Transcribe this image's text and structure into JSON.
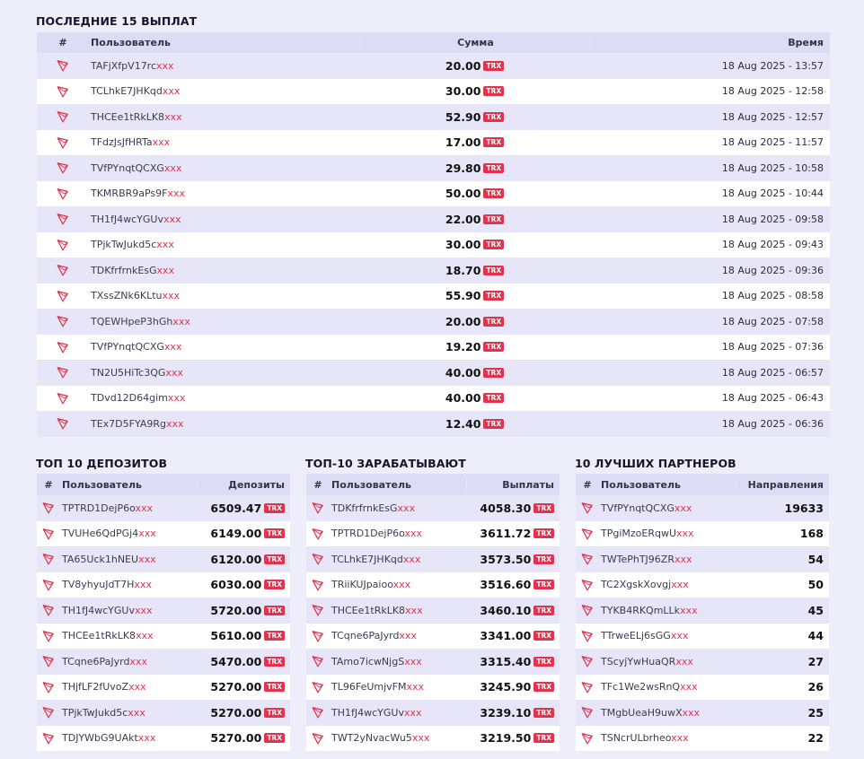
{
  "last_payouts": {
    "title": "ПОСЛЕДНИЕ 15 ВЫПЛАТ",
    "headers": {
      "num": "#",
      "user": "Пользователь",
      "sum": "Сумма",
      "time": "Время"
    },
    "currency": "TRX",
    "mask": "xxx",
    "rows": [
      {
        "user": "TAFjXfpV17rc",
        "amount": "20.00",
        "time": "18 Aug 2025 - 13:57"
      },
      {
        "user": "TCLhkE7JHKqd",
        "amount": "30.00",
        "time": "18 Aug 2025 - 12:58"
      },
      {
        "user": "THCEe1tRkLK8",
        "amount": "52.90",
        "time": "18 Aug 2025 - 12:57"
      },
      {
        "user": "TFdzJsJfHRTa",
        "amount": "17.00",
        "time": "18 Aug 2025 - 11:57"
      },
      {
        "user": "TVfPYnqtQCXG",
        "amount": "29.80",
        "time": "18 Aug 2025 - 10:58"
      },
      {
        "user": "TKMRBR9aPs9F",
        "amount": "50.00",
        "time": "18 Aug 2025 - 10:44"
      },
      {
        "user": "TH1fJ4wcYGUv",
        "amount": "22.00",
        "time": "18 Aug 2025 - 09:58"
      },
      {
        "user": "TPjkTwJukd5c",
        "amount": "30.00",
        "time": "18 Aug 2025 - 09:43"
      },
      {
        "user": "TDKfrfrnkEsG",
        "amount": "18.70",
        "time": "18 Aug 2025 - 09:36"
      },
      {
        "user": "TXssZNk6KLtu",
        "amount": "55.90",
        "time": "18 Aug 2025 - 08:58"
      },
      {
        "user": "TQEWHpeP3hGh",
        "amount": "20.00",
        "time": "18 Aug 2025 - 07:58"
      },
      {
        "user": "TVfPYnqtQCXG",
        "amount": "19.20",
        "time": "18 Aug 2025 - 07:36"
      },
      {
        "user": "TN2U5HiTc3QG",
        "amount": "40.00",
        "time": "18 Aug 2025 - 06:57"
      },
      {
        "user": "TDvd12D64gim",
        "amount": "40.00",
        "time": "18 Aug 2025 - 06:43"
      },
      {
        "user": "TEx7D5FYA9Rg",
        "amount": "12.40",
        "time": "18 Aug 2025 - 06:36"
      }
    ]
  },
  "top_deposits": {
    "title": "ТОП 10 ДЕПОЗИТОВ",
    "headers": {
      "num": "#",
      "user": "Пользователь",
      "value": "Депозиты"
    },
    "rows": [
      {
        "user": "TPTRD1DejP6o",
        "value": "6509.47"
      },
      {
        "user": "TVUHe6QdPGj4",
        "value": "6149.00"
      },
      {
        "user": "TA65Uck1hNEU",
        "value": "6120.00"
      },
      {
        "user": "TV8yhyuJdT7H",
        "value": "6030.00"
      },
      {
        "user": "TH1fJ4wcYGUv",
        "value": "5720.00"
      },
      {
        "user": "THCEe1tRkLK8",
        "value": "5610.00"
      },
      {
        "user": "TCqne6PaJyrd",
        "value": "5470.00"
      },
      {
        "user": "THjfLF2fUvoZ",
        "value": "5270.00"
      },
      {
        "user": "TPjkTwJukd5c",
        "value": "5270.00"
      },
      {
        "user": "TDJYWbG9UAkt",
        "value": "5270.00"
      }
    ]
  },
  "top_earners": {
    "title": "ТОП-10 ЗАРАБАТЫВАЮТ",
    "headers": {
      "num": "#",
      "user": "Пользователь",
      "value": "Выплаты"
    },
    "rows": [
      {
        "user": "TDKfrfrnkEsG",
        "value": "4058.30"
      },
      {
        "user": "TPTRD1DejP6o",
        "value": "3611.72"
      },
      {
        "user": "TCLhkE7JHKqd",
        "value": "3573.50"
      },
      {
        "user": "TRiiKUJpaioo",
        "value": "3516.60"
      },
      {
        "user": "THCEe1tRkLK8",
        "value": "3460.10"
      },
      {
        "user": "TCqne6PaJyrd",
        "value": "3341.00"
      },
      {
        "user": "TAmo7icwNjgS",
        "value": "3315.40"
      },
      {
        "user": "TL96FeUmjvFM",
        "value": "3245.90"
      },
      {
        "user": "TH1fJ4wcYGUv",
        "value": "3239.10"
      },
      {
        "user": "TWT2yNvacWu5",
        "value": "3219.50"
      }
    ]
  },
  "top_partners": {
    "title": "10 ЛУЧШИХ ПАРТНЕРОВ",
    "headers": {
      "num": "#",
      "user": "Пользователь",
      "value": "Направления"
    },
    "rows": [
      {
        "user": "TVfPYnqtQCXG",
        "value": "19633"
      },
      {
        "user": "TPgiMzoERqwU",
        "value": "168"
      },
      {
        "user": "TWTePhTJ96ZR",
        "value": "54"
      },
      {
        "user": "TC2XgskXovgj",
        "value": "50"
      },
      {
        "user": "TYKB4RKQmLLk",
        "value": "45"
      },
      {
        "user": "TTrweELj6sGG",
        "value": "44"
      },
      {
        "user": "TScyjYwHuaQR",
        "value": "27"
      },
      {
        "user": "TFc1We2wsRnQ",
        "value": "26"
      },
      {
        "user": "TMgbUeaH9uwX",
        "value": "25"
      },
      {
        "user": "TSNcrULbrheo",
        "value": "22"
      }
    ]
  },
  "icon": "tron-icon",
  "colors": {
    "accent": "#e0344e",
    "header_bg": "#dcdcf5",
    "row_alt": "#e6e6f8",
    "page_bg": "#eeeefb"
  }
}
